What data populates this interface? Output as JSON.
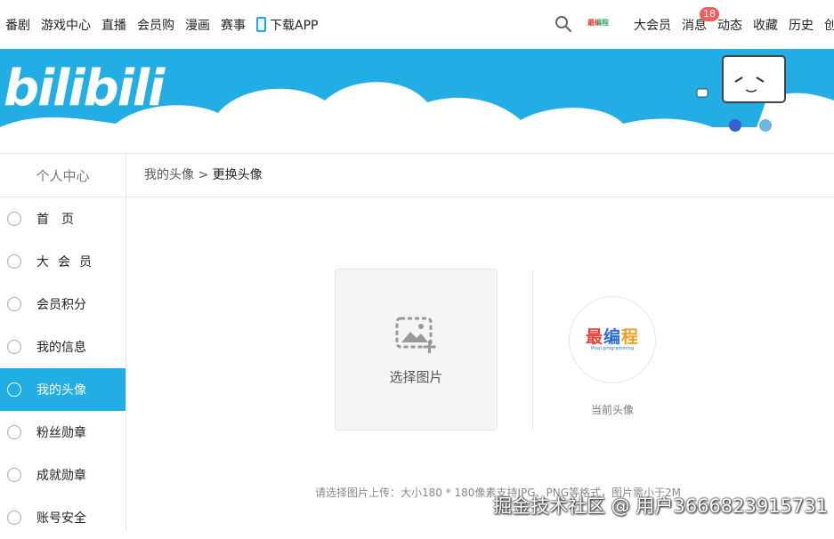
{
  "topnav": {
    "left_items": [
      "番剧",
      "游戏中心",
      "直播",
      "会员购",
      "漫画",
      "赛事"
    ],
    "download_label": "下载APP",
    "mini_logo_text": "最编程",
    "right_items": {
      "vip": "大会员",
      "messages": "消息",
      "messages_badge": "18",
      "dynamics": "动态",
      "favorites": "收藏",
      "history": "历史",
      "create": "创"
    }
  },
  "banner": {
    "logo_text": "bilibili",
    "accent_color": "#23ade5"
  },
  "sidebar": {
    "title": "个人中心",
    "items": [
      {
        "label": "首　页",
        "icon": "home-icon"
      },
      {
        "label": "大会员",
        "icon": "vip-icon"
      },
      {
        "label": "会员积分",
        "icon": "points-icon"
      },
      {
        "label": "我的信息",
        "icon": "user-info-icon"
      },
      {
        "label": "我的头像",
        "icon": "avatar-icon",
        "active": true
      },
      {
        "label": "粉丝勋章",
        "icon": "fan-medal-icon"
      },
      {
        "label": "成就勋章",
        "icon": "achievement-icon"
      },
      {
        "label": "账号安全",
        "icon": "security-icon"
      }
    ]
  },
  "breadcrumb": {
    "parent": "我的头像",
    "separator": ">",
    "current": "更换头像"
  },
  "upload": {
    "label": "选择图片"
  },
  "avatar": {
    "text_a": "最",
    "text_b": "编",
    "text_c": "程",
    "subtext": "Prost programming",
    "caption": "当前头像"
  },
  "hint": "请选择图片上传：大小180 * 180像素支持JPG、PNG等格式，图片需小于2M",
  "watermark": "掘金技术社区 @ 用户3666823915731"
}
